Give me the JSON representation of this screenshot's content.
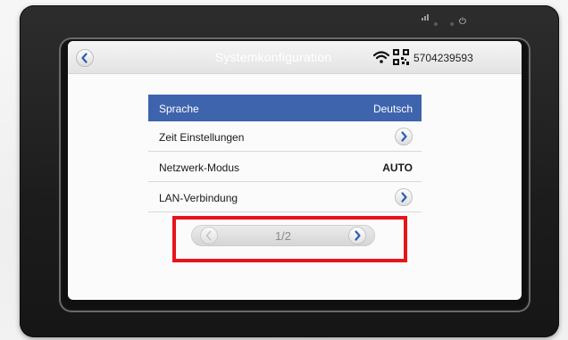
{
  "titlebar": {
    "title": "Systemkonfiguration",
    "serial": "5704239593",
    "back_icon": "back-chevron-icon",
    "wifi_icon": "wifi-icon",
    "qr_icon": "qr-code-icon"
  },
  "settings": [
    {
      "label": "Sprache",
      "value": "Deutsch",
      "selected": true
    },
    {
      "label": "Zeit Einstellungen",
      "control": "chevron-right-icon"
    },
    {
      "label": "Netzwerk-Modus",
      "value": "AUTO"
    },
    {
      "label": "LAN-Verbindung",
      "control": "chevron-right-icon"
    }
  ],
  "pager": {
    "text": "1/2",
    "prev_icon": "chevron-left-icon",
    "next_icon": "chevron-right-icon"
  },
  "colors": {
    "selected_row": "#3e64ad",
    "highlight": "#e8131b",
    "accent_chevron": "#2a5bb8"
  }
}
